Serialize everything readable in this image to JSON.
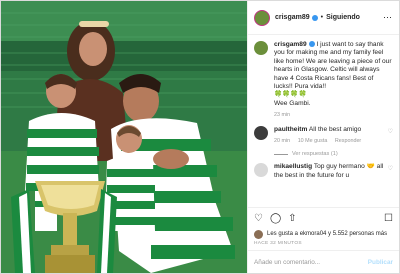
{
  "header": {
    "username": "crisgam89",
    "follow_status": "Siguiendo",
    "separator": "•"
  },
  "caption": {
    "username": "crisgam89",
    "text": "I just want to say thank you for making me and my family feel like home! We are leaving a piece of our hearts in Glasgow. Celtic will always have 4 Costa Ricans fans! Best of lucks!! Pura vida!!",
    "emoji": "🍀🍀🍀🍀",
    "extra": "Wee Gambi.",
    "time": "23 min"
  },
  "comments": [
    {
      "username": "paultheitm",
      "text": "All the best amigo",
      "time": "20 min",
      "likes": "10 Me gusta",
      "reply_label": "Responder",
      "replies": "Ver respuestas (1)"
    },
    {
      "username": "mikaellustig",
      "text": "Top guy hermano 🤝 all the best in the future for u"
    }
  ],
  "footer": {
    "likes_text": "Les gusta a ekmora04 y 5.552 personas más",
    "timestamp": "HACE 32 MINUTOS",
    "comment_placeholder": "Añade un comentario...",
    "publish_label": "Publicar"
  },
  "icons": {
    "heart": "heart-icon",
    "comment": "comment-icon",
    "share": "share-icon",
    "bookmark": "bookmark-icon",
    "more": "more-options-icon",
    "verified": "verified-badge-icon"
  },
  "colors": {
    "verified": "#3897f0",
    "celtic_green": "#1b8a3f",
    "link_blue": "#b2dffc"
  }
}
